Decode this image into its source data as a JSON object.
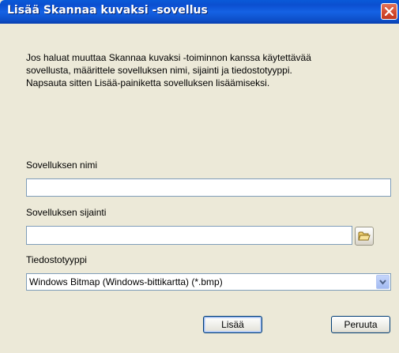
{
  "window": {
    "title": "Lisää Skannaa kuvaksi -sovellus"
  },
  "description": {
    "lines": [
      "Jos haluat muuttaa Skannaa kuvaksi -toiminnon kanssa käytettävää",
      "sovellusta, määrittele sovelluksen nimi, sijainti ja tiedostotyyppi.",
      "Napsauta sitten Lisää-painiketta sovelluksen lisäämiseksi."
    ]
  },
  "form": {
    "app_name": {
      "label": "Sovelluksen nimi",
      "value": ""
    },
    "app_location": {
      "label": "Sovelluksen sijainti",
      "value": "",
      "browse_icon": "folder-icon"
    },
    "file_type": {
      "label": "Tiedostotyyppi",
      "selected": "Windows Bitmap (Windows-bittikartta) (*.bmp)"
    }
  },
  "buttons": {
    "add_label": "Lisää",
    "cancel_label": "Peruuta"
  },
  "colors": {
    "titlebar": "#0b4fd0",
    "close_button": "#d2492d",
    "dialog_background": "#ece9d8"
  }
}
